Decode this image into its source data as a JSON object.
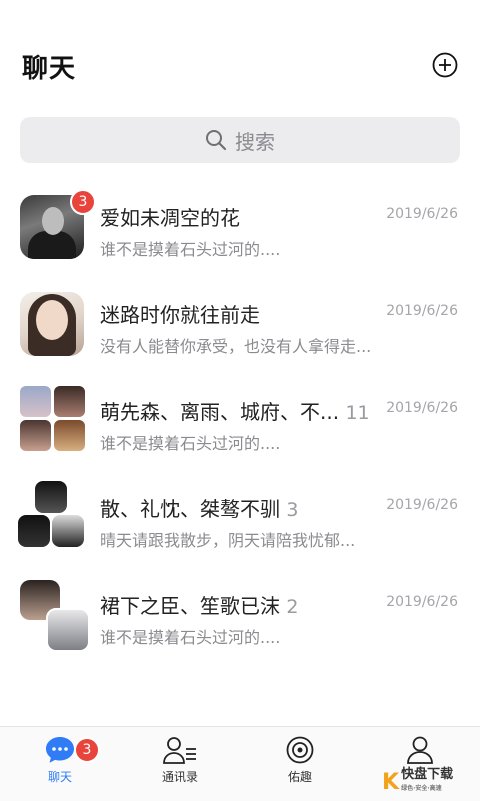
{
  "header": {
    "title": "聊天",
    "add_icon": "plus-circle-icon"
  },
  "search": {
    "label": "搜索",
    "icon": "search-icon"
  },
  "chats": [
    {
      "name": "爱如未凋空的花",
      "preview": "谁不是摸着石头过河的....",
      "date": "2019/6/26",
      "badge": "3",
      "avatar": "single-photo"
    },
    {
      "name": "迷路时你就往前走",
      "preview": "没有人能替你承受，也没有人拿得走...",
      "date": "2019/6/26",
      "avatar": "single-photo"
    },
    {
      "name": "萌先森、离雨、城府、不...",
      "count": "11",
      "preview": "谁不是摸着石头过河的....",
      "date": "2019/6/26",
      "avatar": "group-4"
    },
    {
      "name": "散、礼忱、桀骜不驯",
      "count": "3",
      "preview": "晴天请跟我散步，阴天请陪我忧郁...",
      "date": "2019/6/26",
      "avatar": "group-3"
    },
    {
      "name": "裙下之臣、笙歌已沫",
      "count": "2",
      "preview": "谁不是摸着石头过河的....",
      "date": "2019/6/26",
      "avatar": "group-2"
    }
  ],
  "tabs": [
    {
      "label": "聊天",
      "icon": "chat-bubble-icon",
      "active": true,
      "badge": "3"
    },
    {
      "label": "通讯录",
      "icon": "contacts-icon",
      "active": false
    },
    {
      "label": "佑趣",
      "icon": "discover-icon",
      "active": false
    },
    {
      "label": "",
      "icon": "profile-icon",
      "active": false
    }
  ],
  "colors": {
    "accent": "#2f7cf6",
    "badge": "#e8443b",
    "search_bg": "#ececef"
  },
  "watermark": {
    "logo_letter": "K",
    "text": "快盘下载",
    "sub": "绿色·安全·高速"
  }
}
